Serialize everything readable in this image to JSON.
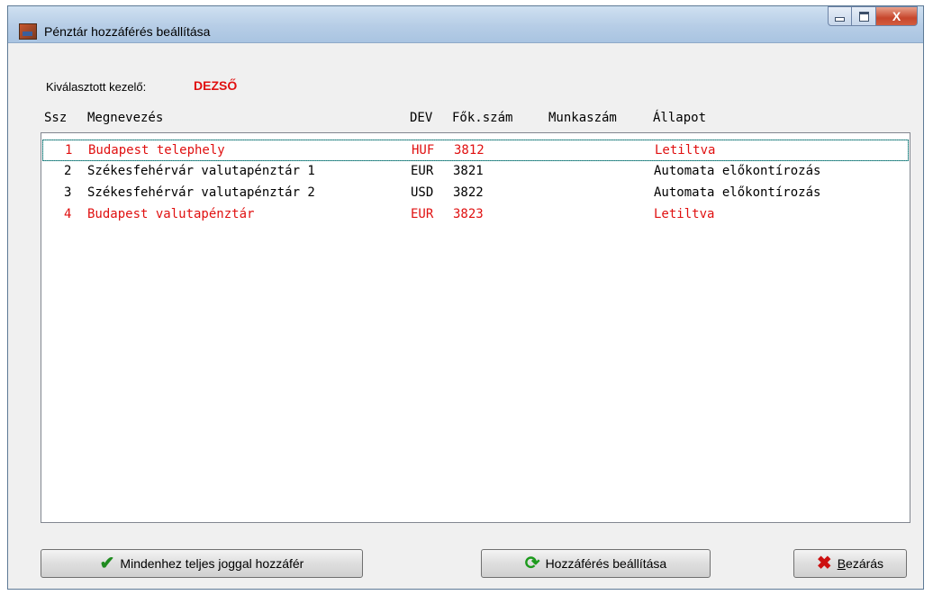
{
  "window": {
    "title": "Pénztár hozzáférés beállítása",
    "controls": {
      "minimize": "",
      "maximize": "",
      "close": "X"
    }
  },
  "operator": {
    "label": "Kiválasztott kezelő:",
    "name": "DEZSŐ"
  },
  "table": {
    "headers": {
      "ssz": "Ssz",
      "name": "Megnevezés",
      "dev": "DEV",
      "account": "Fők.szám",
      "worknum": "Munkaszám",
      "status": "Állapot"
    },
    "rows": [
      {
        "ssz": "1",
        "name": "Budapest telephely",
        "dev": "HUF",
        "account": "3812",
        "worknum": "",
        "status": "Letiltva",
        "color": "red",
        "selected": true
      },
      {
        "ssz": "2",
        "name": "Székesfehérvár valutapénztár 1",
        "dev": "EUR",
        "account": "3821",
        "worknum": "",
        "status": "Automata előkontírozás",
        "color": "black",
        "selected": false
      },
      {
        "ssz": "3",
        "name": "Székesfehérvár valutapénztár 2",
        "dev": "USD",
        "account": "3822",
        "worknum": "",
        "status": "Automata előkontírozás",
        "color": "black",
        "selected": false
      },
      {
        "ssz": "4",
        "name": "Budapest valutapénztár",
        "dev": "EUR",
        "account": "3823",
        "worknum": "",
        "status": "Letiltva",
        "color": "red",
        "selected": false
      }
    ]
  },
  "buttons": {
    "full_access": "Mindenhez teljes joggal hozzáfér",
    "set_access": "Hozzáférés beállítása",
    "close": "Bezárás"
  },
  "colors": {
    "disabled_text": "#e01010",
    "normal_text": "#000000",
    "operator_name": "#e01010"
  }
}
